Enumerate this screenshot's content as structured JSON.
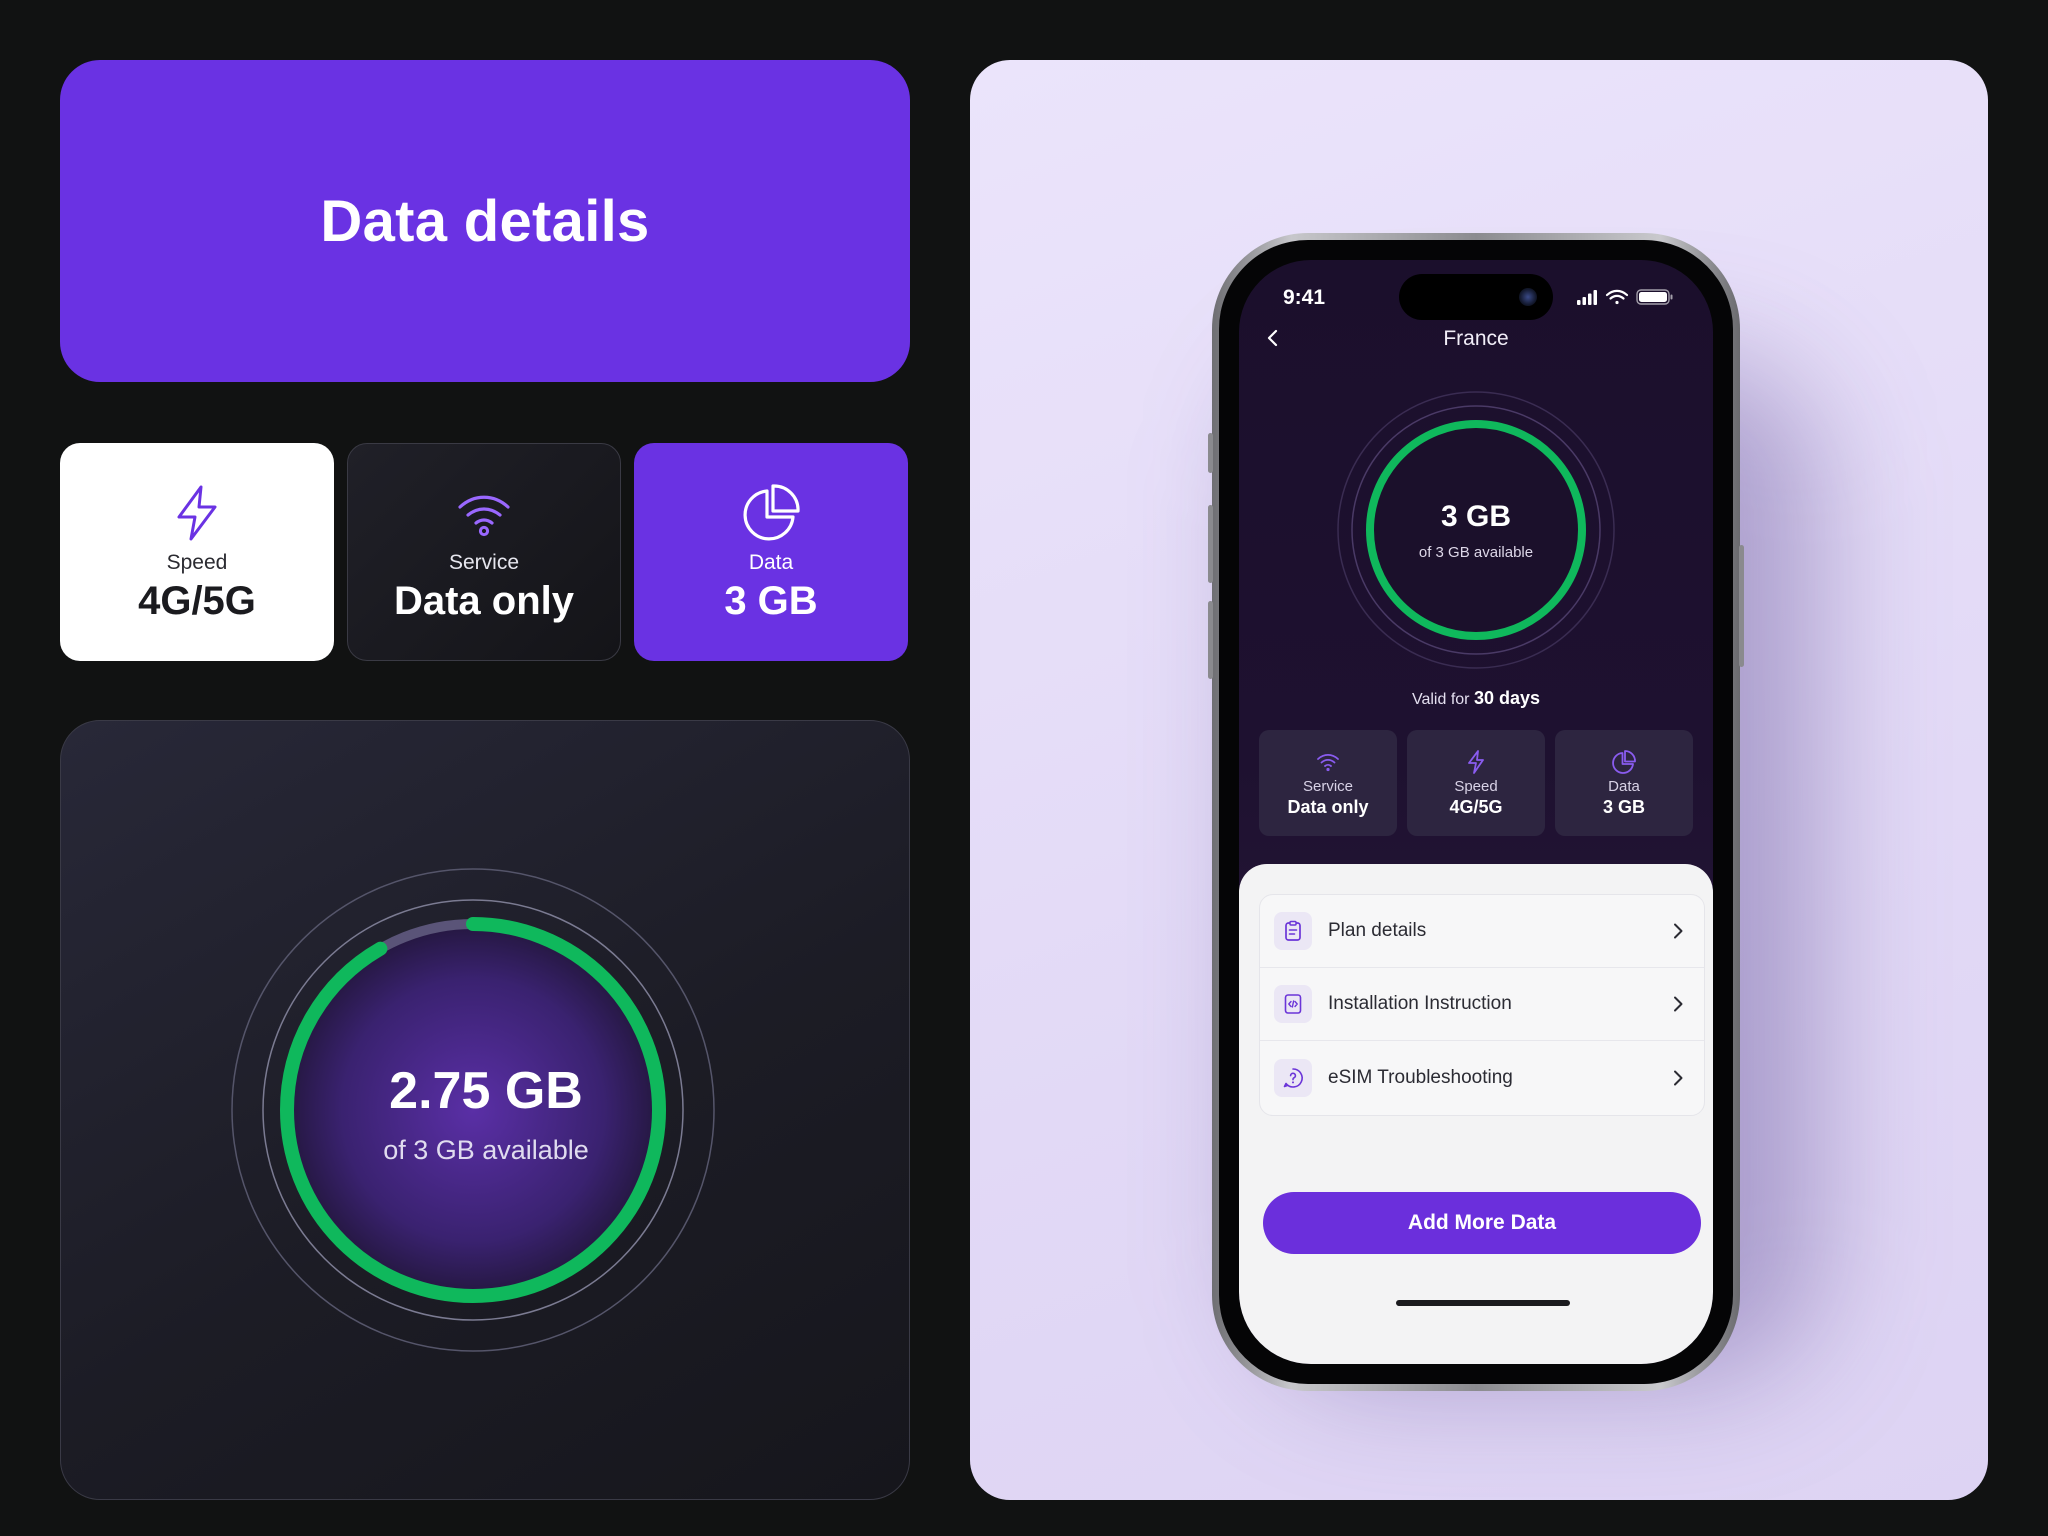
{
  "hero": {
    "title": "Data details"
  },
  "stats": [
    {
      "label": "Speed",
      "value": "4G/5G",
      "icon": "lightning-icon"
    },
    {
      "label": "Service",
      "value": "Data only",
      "icon": "wifi-icon"
    },
    {
      "label": "Data",
      "value": "3 GB",
      "icon": "pie-chart-icon"
    }
  ],
  "gauge": {
    "used_label": "2.75 GB",
    "sub_label": "of 3 GB available",
    "remaining_gb": 2.75,
    "total_gb": 3
  },
  "phone": {
    "status": {
      "time": "9:41"
    },
    "nav": {
      "title": "France",
      "back_icon": "chevron-left-icon"
    },
    "ring": {
      "main": "3 GB",
      "sub": "of 3 GB available",
      "remaining_gb": 3,
      "total_gb": 3
    },
    "validity": {
      "prefix": "Valid for",
      "days": "30 days"
    },
    "cards": [
      {
        "label": "Service",
        "value": "Data only",
        "icon": "wifi-icon"
      },
      {
        "label": "Speed",
        "value": "4G/5G",
        "icon": "lightning-icon"
      },
      {
        "label": "Data",
        "value": "3 GB",
        "icon": "pie-chart-icon"
      }
    ],
    "menu": [
      {
        "label": "Plan details",
        "icon": "clipboard-icon"
      },
      {
        "label": "Installation Instruction",
        "icon": "code-document-icon"
      },
      {
        "label": "eSIM Troubleshooting",
        "icon": "question-icon"
      }
    ],
    "cta": "Add More Data"
  },
  "colors": {
    "brand_purple": "#6a32e3",
    "ring_green": "#0fb85c",
    "background": "#111212",
    "showcase_bg": "#e7e0f8"
  }
}
